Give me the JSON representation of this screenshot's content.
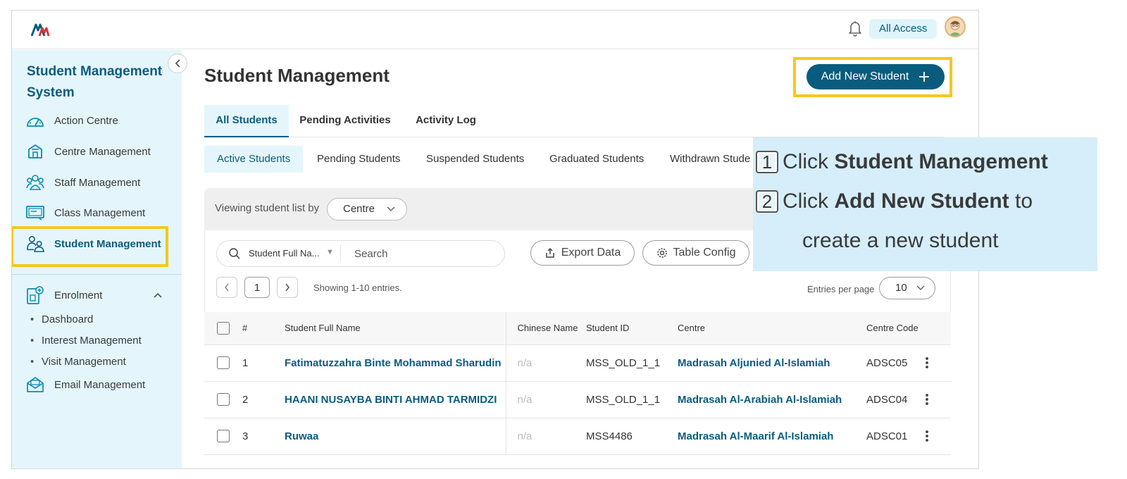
{
  "topbar": {
    "access_label": "All Access"
  },
  "sidebar": {
    "title": "Student Management System",
    "items": [
      {
        "label": "Action Centre",
        "icon": "gauge-icon"
      },
      {
        "label": "Centre Management",
        "icon": "building-icon"
      },
      {
        "label": "Staff Management",
        "icon": "people-icon"
      },
      {
        "label": "Class Management",
        "icon": "classroom-icon"
      },
      {
        "label": "Student Management",
        "icon": "students-icon",
        "active": true
      }
    ],
    "enrolment": {
      "label": "Enrolment",
      "subitems": [
        "Dashboard",
        "Interest Management",
        "Visit Management"
      ]
    },
    "email": {
      "label": "Email Management"
    }
  },
  "main": {
    "title": "Student Management",
    "add_button_label": "Add New Student",
    "tabs": [
      "All Students",
      "Pending Activities",
      "Activity Log"
    ],
    "subtabs": [
      "Active Students",
      "Pending Students",
      "Suspended Students",
      "Graduated Students",
      "Withdrawn Stude"
    ],
    "filter": {
      "label": "Viewing student list by",
      "value": "Centre"
    },
    "search": {
      "field": "Student Full Na...",
      "placeholder": "Search"
    },
    "export_label": "Export Data",
    "config_label": "Table Config",
    "pager": {
      "page": "1",
      "showing": "Showing 1-10 entries."
    },
    "entries": {
      "label": "Entries per page",
      "value": "10"
    },
    "table": {
      "headers": [
        "#",
        "Student Full Name",
        "Chinese Name",
        "Student ID",
        "Centre",
        "Centre Code"
      ],
      "rows": [
        {
          "num": "1",
          "name": "Fatimatuzzahra Binte Mohammad Sharudin",
          "chinese": "n/a",
          "id": "MSS_OLD_1_1",
          "centre": "Madrasah Aljunied Al-Islamiah",
          "code": "ADSC05"
        },
        {
          "num": "2",
          "name": "HAANI NUSAYBA BINTI AHMAD TARMIDZI",
          "chinese": "n/a",
          "id": "MSS_OLD_1_1",
          "centre": "Madrasah Al-Arabiah Al-Islamiah",
          "code": "ADSC04"
        },
        {
          "num": "3",
          "name": "Ruwaa",
          "chinese": "n/a",
          "id": "MSS4486",
          "centre": "Madrasah Al-Maarif Al-Islamiah",
          "code": "ADSC01"
        }
      ]
    }
  },
  "instructions": {
    "step1_num": "1",
    "step1_pre": "Click ",
    "step1_bold": "Student Management",
    "step2_num": "2",
    "step2_pre": "Click ",
    "step2_bold": "Add New Student",
    "step2_post": " to",
    "step2_cont": "create a new student"
  },
  "colors": {
    "brand": "#0a5c7e",
    "highlight": "#f7c71b",
    "sidebar_bg": "#e4f6fb",
    "instruction_bg": "#d5eefa"
  }
}
